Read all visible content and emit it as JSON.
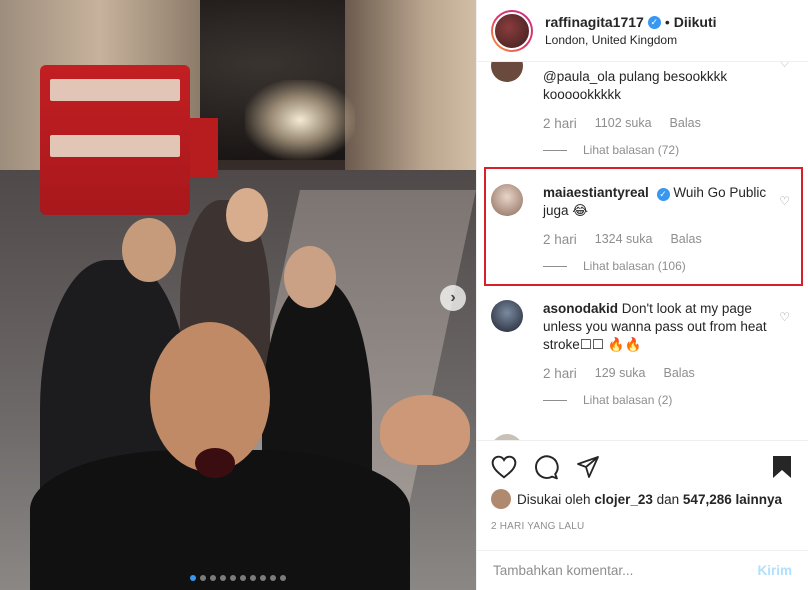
{
  "header": {
    "username": "raffinagita1717",
    "follow_status": "Diikuti",
    "separator": "•",
    "location": "London, United Kingdom"
  },
  "comments": [
    {
      "username": "",
      "text": "@paula_ola pulang besookkkk koooookkkkk",
      "time": "2 hari",
      "likes": "1102 suka",
      "reply": "Balas",
      "view_replies": "Lihat balasan (72)"
    },
    {
      "username": "maiaestiantyreal",
      "verified": true,
      "text": "Wuih Go Public juga 😂",
      "time": "2 hari",
      "likes": "1324 suka",
      "reply": "Balas",
      "view_replies": "Lihat balasan (106)"
    },
    {
      "username": "asonodakid",
      "text": "Don't look at my page unless you wanna pass out from heat stroke☐☐ 🔥🔥",
      "time": "2 hari",
      "likes": "129 suka",
      "reply": "Balas",
      "view_replies": "Lihat balasan (2)"
    }
  ],
  "likes": {
    "prefix": "Disukai oleh",
    "user": "clojer_23",
    "connector": "dan",
    "others": "547,286 lainnya"
  },
  "date": "2 HARI YANG LALU",
  "add_comment": {
    "placeholder": "Tambahkan komentar...",
    "post_label": "Kirim"
  },
  "carousel": {
    "slide_count": 10,
    "active_index": 0
  },
  "colors": {
    "accent": "#3897f0",
    "highlight": "#d8202a",
    "post_disabled": "#b2dffc"
  }
}
